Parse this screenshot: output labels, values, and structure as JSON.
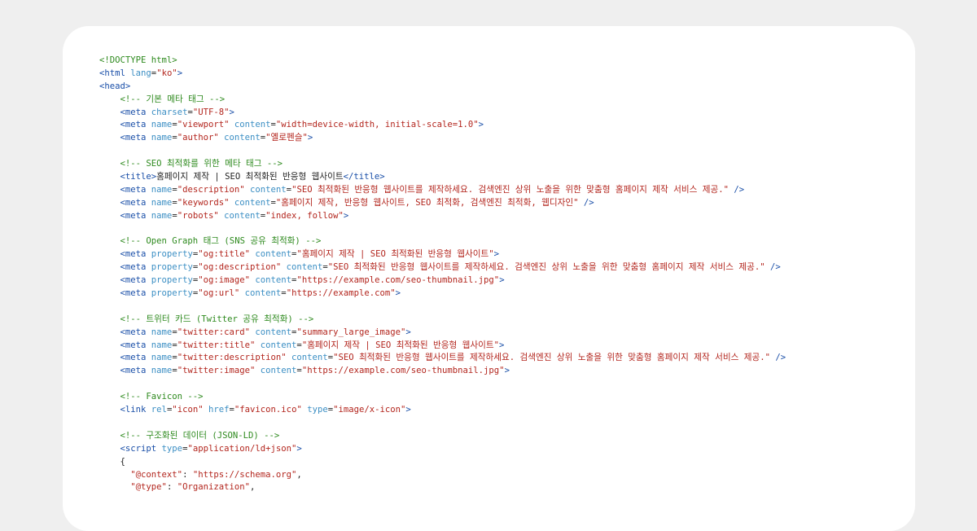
{
  "colors": {
    "background": "#efefef",
    "card": "#ffffff",
    "tag": "#1a4fa8",
    "attr": "#3c8fc4",
    "value": "#b3261e",
    "comment": "#2e8a1e",
    "text": "#222222"
  },
  "code": {
    "lines": [
      [
        {
          "t": "comment",
          "v": "<!DOCTYPE html>"
        }
      ],
      [
        {
          "t": "tag",
          "v": "<html "
        },
        {
          "t": "attr",
          "v": "lang"
        },
        {
          "t": "text",
          "v": "="
        },
        {
          "t": "val",
          "v": "\"ko\""
        },
        {
          "t": "tag",
          "v": ">"
        }
      ],
      [
        {
          "t": "tag",
          "v": "<head>"
        }
      ],
      [
        {
          "t": "text",
          "v": "    "
        },
        {
          "t": "comment",
          "v": "<!-- 기본 메타 태그 -->"
        }
      ],
      [
        {
          "t": "text",
          "v": "    "
        },
        {
          "t": "tag",
          "v": "<meta "
        },
        {
          "t": "attr",
          "v": "charset"
        },
        {
          "t": "text",
          "v": "="
        },
        {
          "t": "val",
          "v": "\"UTF-8\""
        },
        {
          "t": "tag",
          "v": ">"
        }
      ],
      [
        {
          "t": "text",
          "v": "    "
        },
        {
          "t": "tag",
          "v": "<meta "
        },
        {
          "t": "attr",
          "v": "name"
        },
        {
          "t": "text",
          "v": "="
        },
        {
          "t": "val",
          "v": "\"viewport\""
        },
        {
          "t": "text",
          "v": " "
        },
        {
          "t": "attr",
          "v": "content"
        },
        {
          "t": "text",
          "v": "="
        },
        {
          "t": "val",
          "v": "\"width=device-width, initial-scale=1.0\""
        },
        {
          "t": "tag",
          "v": ">"
        }
      ],
      [
        {
          "t": "text",
          "v": "    "
        },
        {
          "t": "tag",
          "v": "<meta "
        },
        {
          "t": "attr",
          "v": "name"
        },
        {
          "t": "text",
          "v": "="
        },
        {
          "t": "val",
          "v": "\"author\""
        },
        {
          "t": "text",
          "v": " "
        },
        {
          "t": "attr",
          "v": "content"
        },
        {
          "t": "text",
          "v": "="
        },
        {
          "t": "val",
          "v": "\"옐로펜슬\""
        },
        {
          "t": "tag",
          "v": ">"
        }
      ],
      [],
      [
        {
          "t": "text",
          "v": "    "
        },
        {
          "t": "comment",
          "v": "<!-- SEO 최적화를 위한 메타 태그 -->"
        }
      ],
      [
        {
          "t": "text",
          "v": "    "
        },
        {
          "t": "tag",
          "v": "<title>"
        },
        {
          "t": "text",
          "v": "홈페이지 제작 | SEO 최적화된 반응형 웹사이트"
        },
        {
          "t": "tag",
          "v": "</title>"
        }
      ],
      [
        {
          "t": "text",
          "v": "    "
        },
        {
          "t": "tag",
          "v": "<meta "
        },
        {
          "t": "attr",
          "v": "name"
        },
        {
          "t": "text",
          "v": "="
        },
        {
          "t": "val",
          "v": "\"description\""
        },
        {
          "t": "text",
          "v": " "
        },
        {
          "t": "attr",
          "v": "content"
        },
        {
          "t": "text",
          "v": "="
        },
        {
          "t": "val",
          "v": "\"SEO 최적화된 반응형 웹사이트를 제작하세요. 검색엔진 상위 노출을 위한 맞춤형 홈페이지 제작 서비스 제공.\""
        },
        {
          "t": "tag",
          "v": " />"
        }
      ],
      [
        {
          "t": "text",
          "v": "    "
        },
        {
          "t": "tag",
          "v": "<meta "
        },
        {
          "t": "attr",
          "v": "name"
        },
        {
          "t": "text",
          "v": "="
        },
        {
          "t": "val",
          "v": "\"keywords\""
        },
        {
          "t": "text",
          "v": " "
        },
        {
          "t": "attr",
          "v": "content"
        },
        {
          "t": "text",
          "v": "="
        },
        {
          "t": "val",
          "v": "\"홈페이지 제작, 반응형 웹사이트, SEO 최적화, 검색엔진 최적화, 웹디자인\""
        },
        {
          "t": "tag",
          "v": " />"
        }
      ],
      [
        {
          "t": "text",
          "v": "    "
        },
        {
          "t": "tag",
          "v": "<meta "
        },
        {
          "t": "attr",
          "v": "name"
        },
        {
          "t": "text",
          "v": "="
        },
        {
          "t": "val",
          "v": "\"robots\""
        },
        {
          "t": "text",
          "v": " "
        },
        {
          "t": "attr",
          "v": "content"
        },
        {
          "t": "text",
          "v": "="
        },
        {
          "t": "val",
          "v": "\"index, follow\""
        },
        {
          "t": "tag",
          "v": ">"
        }
      ],
      [],
      [
        {
          "t": "text",
          "v": "    "
        },
        {
          "t": "comment",
          "v": "<!-- Open Graph 태그 (SNS 공유 최적화) -->"
        }
      ],
      [
        {
          "t": "text",
          "v": "    "
        },
        {
          "t": "tag",
          "v": "<meta "
        },
        {
          "t": "attr",
          "v": "property"
        },
        {
          "t": "text",
          "v": "="
        },
        {
          "t": "val",
          "v": "\"og:title\""
        },
        {
          "t": "text",
          "v": " "
        },
        {
          "t": "attr",
          "v": "content"
        },
        {
          "t": "text",
          "v": "="
        },
        {
          "t": "val",
          "v": "\"홈페이지 제작 | SEO 최적화된 반응형 웹사이트\""
        },
        {
          "t": "tag",
          "v": ">"
        }
      ],
      [
        {
          "t": "text",
          "v": "    "
        },
        {
          "t": "tag",
          "v": "<meta "
        },
        {
          "t": "attr",
          "v": "property"
        },
        {
          "t": "text",
          "v": "="
        },
        {
          "t": "val",
          "v": "\"og:description\""
        },
        {
          "t": "text",
          "v": " "
        },
        {
          "t": "attr",
          "v": "content"
        },
        {
          "t": "text",
          "v": "="
        },
        {
          "t": "val",
          "v": "\"SEO 최적화된 반응형 웹사이트를 제작하세요. 검색엔진 상위 노출을 위한 맞춤형 홈페이지 제작 서비스 제공.\""
        },
        {
          "t": "tag",
          "v": " />"
        }
      ],
      [
        {
          "t": "text",
          "v": "    "
        },
        {
          "t": "tag",
          "v": "<meta "
        },
        {
          "t": "attr",
          "v": "property"
        },
        {
          "t": "text",
          "v": "="
        },
        {
          "t": "val",
          "v": "\"og:image\""
        },
        {
          "t": "text",
          "v": " "
        },
        {
          "t": "attr",
          "v": "content"
        },
        {
          "t": "text",
          "v": "="
        },
        {
          "t": "val",
          "v": "\"https://example.com/seo-thumbnail.jpg\""
        },
        {
          "t": "tag",
          "v": ">"
        }
      ],
      [
        {
          "t": "text",
          "v": "    "
        },
        {
          "t": "tag",
          "v": "<meta "
        },
        {
          "t": "attr",
          "v": "property"
        },
        {
          "t": "text",
          "v": "="
        },
        {
          "t": "val",
          "v": "\"og:url\""
        },
        {
          "t": "text",
          "v": " "
        },
        {
          "t": "attr",
          "v": "content"
        },
        {
          "t": "text",
          "v": "="
        },
        {
          "t": "val",
          "v": "\"https://example.com\""
        },
        {
          "t": "tag",
          "v": ">"
        }
      ],
      [],
      [
        {
          "t": "text",
          "v": "    "
        },
        {
          "t": "comment",
          "v": "<!-- 트위터 카드 (Twitter 공유 최적화) -->"
        }
      ],
      [
        {
          "t": "text",
          "v": "    "
        },
        {
          "t": "tag",
          "v": "<meta "
        },
        {
          "t": "attr",
          "v": "name"
        },
        {
          "t": "text",
          "v": "="
        },
        {
          "t": "val",
          "v": "\"twitter:card\""
        },
        {
          "t": "text",
          "v": " "
        },
        {
          "t": "attr",
          "v": "content"
        },
        {
          "t": "text",
          "v": "="
        },
        {
          "t": "val",
          "v": "\"summary_large_image\""
        },
        {
          "t": "tag",
          "v": ">"
        }
      ],
      [
        {
          "t": "text",
          "v": "    "
        },
        {
          "t": "tag",
          "v": "<meta "
        },
        {
          "t": "attr",
          "v": "name"
        },
        {
          "t": "text",
          "v": "="
        },
        {
          "t": "val",
          "v": "\"twitter:title\""
        },
        {
          "t": "text",
          "v": " "
        },
        {
          "t": "attr",
          "v": "content"
        },
        {
          "t": "text",
          "v": "="
        },
        {
          "t": "val",
          "v": "\"홈페이지 제작 | SEO 최적화된 반응형 웹사이트\""
        },
        {
          "t": "tag",
          "v": ">"
        }
      ],
      [
        {
          "t": "text",
          "v": "    "
        },
        {
          "t": "tag",
          "v": "<meta "
        },
        {
          "t": "attr",
          "v": "name"
        },
        {
          "t": "text",
          "v": "="
        },
        {
          "t": "val",
          "v": "\"twitter:description\""
        },
        {
          "t": "text",
          "v": " "
        },
        {
          "t": "attr",
          "v": "content"
        },
        {
          "t": "text",
          "v": "="
        },
        {
          "t": "val",
          "v": "\"SEO 최적화된 반응형 웹사이트를 제작하세요. 검색엔진 상위 노출을 위한 맞춤형 홈페이지 제작 서비스 제공.\""
        },
        {
          "t": "tag",
          "v": " />"
        }
      ],
      [
        {
          "t": "text",
          "v": "    "
        },
        {
          "t": "tag",
          "v": "<meta "
        },
        {
          "t": "attr",
          "v": "name"
        },
        {
          "t": "text",
          "v": "="
        },
        {
          "t": "val",
          "v": "\"twitter:image\""
        },
        {
          "t": "text",
          "v": " "
        },
        {
          "t": "attr",
          "v": "content"
        },
        {
          "t": "text",
          "v": "="
        },
        {
          "t": "val",
          "v": "\"https://example.com/seo-thumbnail.jpg\""
        },
        {
          "t": "tag",
          "v": ">"
        }
      ],
      [],
      [
        {
          "t": "text",
          "v": "    "
        },
        {
          "t": "comment",
          "v": "<!-- Favicon -->"
        }
      ],
      [
        {
          "t": "text",
          "v": "    "
        },
        {
          "t": "tag",
          "v": "<link "
        },
        {
          "t": "attr",
          "v": "rel"
        },
        {
          "t": "text",
          "v": "="
        },
        {
          "t": "val",
          "v": "\"icon\""
        },
        {
          "t": "text",
          "v": " "
        },
        {
          "t": "attr",
          "v": "href"
        },
        {
          "t": "text",
          "v": "="
        },
        {
          "t": "val",
          "v": "\"favicon.ico\""
        },
        {
          "t": "text",
          "v": " "
        },
        {
          "t": "attr",
          "v": "type"
        },
        {
          "t": "text",
          "v": "="
        },
        {
          "t": "val",
          "v": "\"image/x-icon\""
        },
        {
          "t": "tag",
          "v": ">"
        }
      ],
      [],
      [
        {
          "t": "text",
          "v": "    "
        },
        {
          "t": "comment",
          "v": "<!-- 구조화된 데이터 (JSON-LD) -->"
        }
      ],
      [
        {
          "t": "text",
          "v": "    "
        },
        {
          "t": "tag",
          "v": "<script "
        },
        {
          "t": "attr",
          "v": "type"
        },
        {
          "t": "text",
          "v": "="
        },
        {
          "t": "val",
          "v": "\"application/ld+json\""
        },
        {
          "t": "tag",
          "v": ">"
        }
      ],
      [
        {
          "t": "text",
          "v": "    {"
        }
      ],
      [
        {
          "t": "text",
          "v": "      "
        },
        {
          "t": "val",
          "v": "\"@context\""
        },
        {
          "t": "text",
          "v": ": "
        },
        {
          "t": "val",
          "v": "\"https://schema.org\""
        },
        {
          "t": "text",
          "v": ","
        }
      ],
      [
        {
          "t": "text",
          "v": "      "
        },
        {
          "t": "val",
          "v": "\"@type\""
        },
        {
          "t": "text",
          "v": ": "
        },
        {
          "t": "val",
          "v": "\"Organization\""
        },
        {
          "t": "text",
          "v": ","
        }
      ]
    ]
  }
}
